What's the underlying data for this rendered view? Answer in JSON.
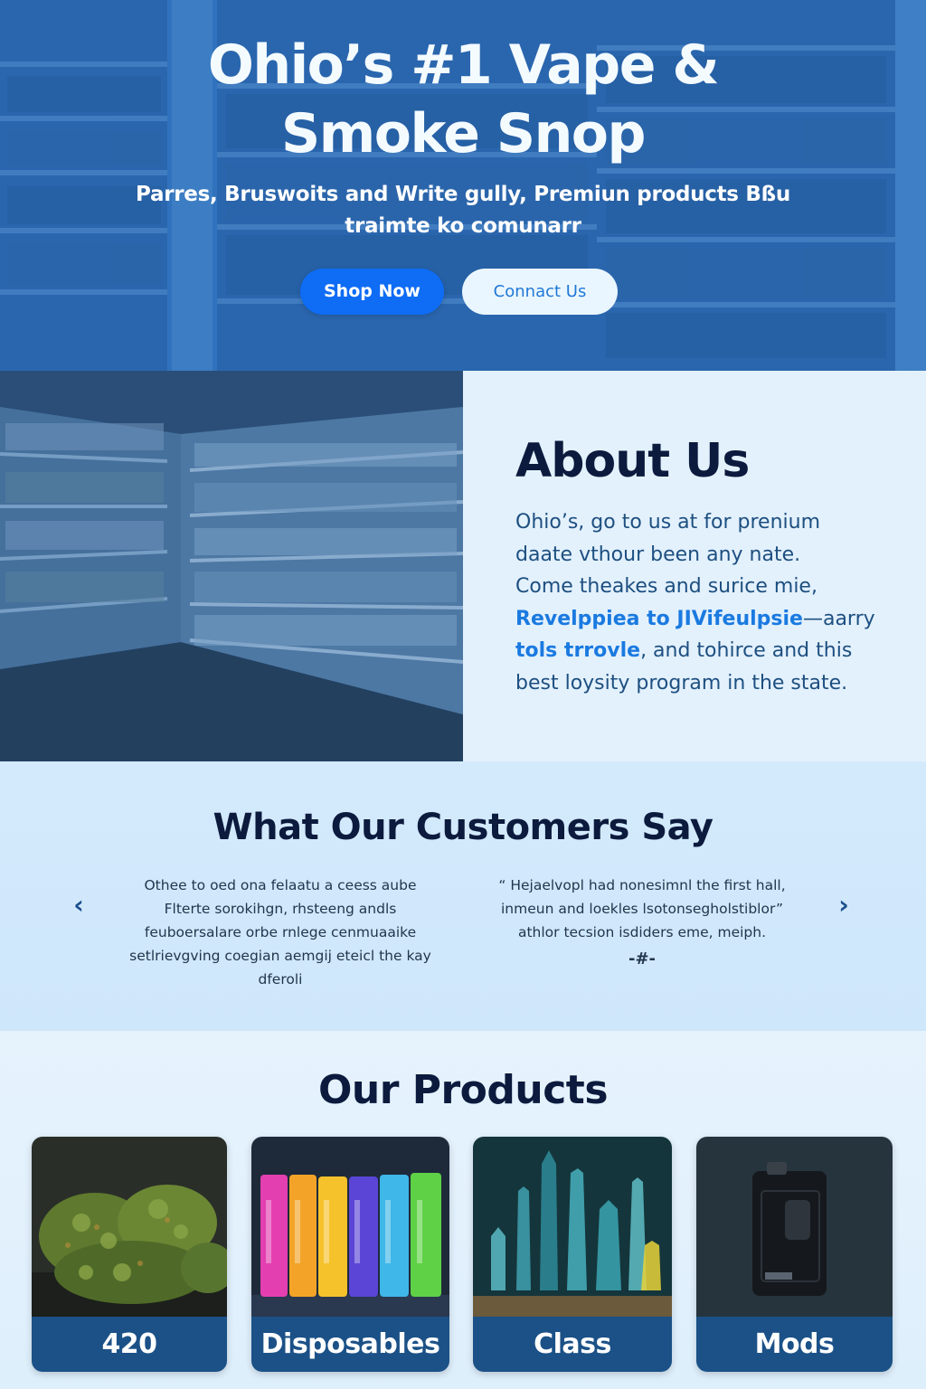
{
  "hero": {
    "title": "Ohio’s #1 Vape & Smoke Snop",
    "subtitle": "Parres, Bruswoits and Write gully, Premiun products Bßu traimte ko comunarr",
    "shop_button": "Shop Now",
    "contact_button": "Connact Us"
  },
  "about": {
    "title": "About Us",
    "line1": "Ohio’s, go to us at for prenium",
    "line2": "daate vthour been any nate.",
    "line3": "Come theakes and surice mie,",
    "line4_link": "Revelppiea to JIVifeulpsie",
    "line4_rest": "—aarry",
    "line5_link": "tols trrovle",
    "line5_rest": ", and tohirce and this",
    "line6": "best loysity program in the state."
  },
  "testimonials": {
    "title": "What Our Customers Say",
    "prev_icon": "chevron-left-icon",
    "next_icon": "chevron-right-icon",
    "quote1": "Othee to oed ona felaatu a ceess aube Flterte sorokihgn, rhsteeng andls feuboersalare orbe rnlege cenmuaaike setlrievgving coegian aemgij eteicl the kay dferoli",
    "quote2": "“ Hejaelvopl had nonesimnl the first hall, inmeun and loekles lsotonsegholstiblor” athlor tecsion isdiders eme, meiph.",
    "quote2_author": "-#-"
  },
  "products": {
    "title": "Our Products",
    "items": [
      {
        "label": "420",
        "image": "cannabis-buds"
      },
      {
        "label": "Disposables",
        "image": "colorful-disposable-vapes"
      },
      {
        "label": "Class",
        "image": "glass-pieces"
      },
      {
        "label": "Mods",
        "image": "vape-mod-device"
      }
    ]
  },
  "colors": {
    "hero_blue": "#2f6fb3",
    "button_blue": "#0e6cf5",
    "navy": "#0b1a3d",
    "card_label": "#1b5187",
    "link_blue": "#1a7ae0"
  }
}
